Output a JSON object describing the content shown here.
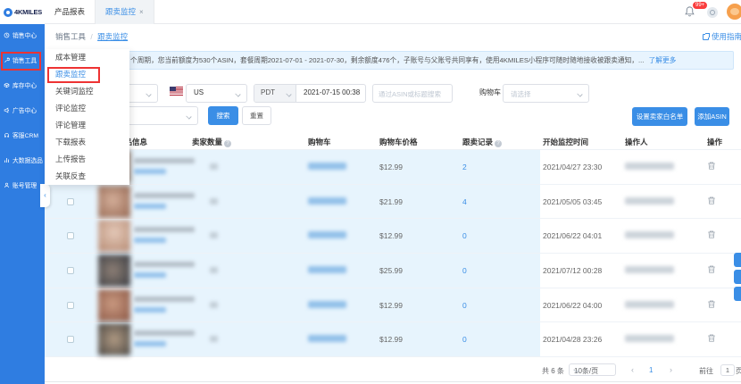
{
  "brand": {
    "logo_text": "4KMILES"
  },
  "sidebar": {
    "items": [
      {
        "label": "销售中心",
        "icon": "sales-center-icon"
      },
      {
        "label": "销售工具",
        "icon": "sales-tools-icon"
      },
      {
        "label": "库存中心",
        "icon": "inventory-center-icon"
      },
      {
        "label": "广告中心",
        "icon": "ads-center-icon"
      },
      {
        "label": "客服CRM",
        "icon": "crm-icon"
      },
      {
        "label": "大数据选品",
        "icon": "bigdata-icon"
      },
      {
        "label": "账号管理",
        "icon": "account-icon"
      }
    ]
  },
  "tabs": [
    {
      "label": "产品报表"
    },
    {
      "label": "跟卖监控",
      "close": "×"
    }
  ],
  "topbar": {
    "notification_badge": "99+",
    "guide_link": "使用指南"
  },
  "breadcrumb": {
    "parent": "销售工具",
    "separator": "/",
    "current": "跟卖监控"
  },
  "dropdown_menu": {
    "items": [
      "成本管理",
      "跟卖监控",
      "关键词监控",
      "评论监控",
      "评论管理",
      "下载报表",
      "上传报告",
      "关联反查"
    ],
    "active_item": "跟卖监控"
  },
  "notice": {
    "text": "个周期，您当前额度为530个ASIN，套餐周期2021-07-01 - 2021-07-30，剩余额度476个，子账号与父账号共同享有，使用4KMILES小程序可随时随地接收被跟卖通知，",
    "ellipsis": "...",
    "link": "了解更多"
  },
  "filters": {
    "marketplace_value": "US",
    "timezone_value": "PDT",
    "datetime_value": "2021-07-15 00:38",
    "asin_search_placeholder": "通过ASIN或标题搜索",
    "cart_label": "购物车",
    "cart_placeholder": "请选择",
    "search_button": "搜索",
    "reset_button": "重置"
  },
  "actions": {
    "whitelist_button": "设置卖家白名单",
    "add_asin_button": "添加ASIN"
  },
  "table": {
    "headers": {
      "product": "商品信息",
      "sellers": "卖家数量",
      "cart": "购物车",
      "cart_price": "购物车价格",
      "records": "跟卖记录",
      "start_time": "开始监控时间",
      "operator": "操作人",
      "action": "操作"
    },
    "rows": [
      {
        "cart_price": "$12.99",
        "records": "2",
        "start_time": "2021/04/27 23:30"
      },
      {
        "cart_price": "$21.99",
        "records": "4",
        "start_time": "2021/05/05 03:45"
      },
      {
        "cart_price": "$12.99",
        "records": "0",
        "start_time": "2021/06/22 04:01"
      },
      {
        "cart_price": "$25.99",
        "records": "0",
        "start_time": "2021/07/12 00:28"
      },
      {
        "cart_price": "$12.99",
        "records": "0",
        "start_time": "2021/06/22 04:00"
      },
      {
        "cart_price": "$12.99",
        "records": "0",
        "start_time": "2021/04/28 23:26"
      }
    ]
  },
  "pagination": {
    "total": "共 6 条",
    "page_size": "10条/页",
    "prev": "‹",
    "current_page": "1",
    "next": "›",
    "goto_label": "前往",
    "goto_value": "1",
    "unit_label": "页"
  }
}
